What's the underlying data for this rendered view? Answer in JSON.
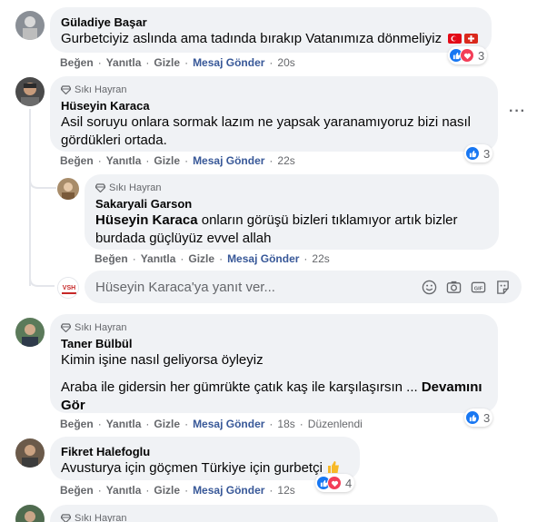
{
  "actions": {
    "like": "Beğen",
    "reply": "Yanıtla",
    "hide": "Gizle",
    "send_message": "Mesaj Gönder",
    "edited": "Düzenlendi"
  },
  "badge_label": "Sıkı Hayran",
  "comments": [
    {
      "name": "Güladiye Başar",
      "text": "Gurbetciyiz aslında ama tadında bırakıp Vatanımıza dönmeliyiz",
      "time": "20s",
      "reactions": "3"
    },
    {
      "name": "Hüseyin Karaca",
      "text": "Asil soruyu onlara sormak lazım ne yapsak yaranamıyoruz bizi nasıl gördükleri ortada.",
      "time": "22s",
      "reactions": "3"
    },
    {
      "name": "Sakaryali Garson",
      "mention": "Hüseyin Karaca",
      "text": " onların görüşü bizleri tıklamıyor artık bizler burdada güçlüyüz evvel allah",
      "time": "22s"
    },
    {
      "name": "Taner Bülbül",
      "text": "Kimin işine nasıl geliyorsa öyleyiz",
      "text2": "Araba ile gidersin her gümrükte çatık kaş ile karşılaşırsın ...",
      "more": "Devamını Gör",
      "time": "18s",
      "reactions": "3"
    },
    {
      "name": "Fikret Halefoglu",
      "text": "Avusturya için göçmen Türkiye için gurbetçi",
      "time": "12s",
      "reactions": "4"
    }
  ],
  "reply_box": {
    "placeholder": "Hüseyin Karaca'ya yanıt ver...",
    "avatar_text": "VSH"
  },
  "colors": {
    "bubble": "#f0f2f5",
    "like": "#1877f2",
    "love": "#f33e58",
    "send_link": "#385898"
  }
}
